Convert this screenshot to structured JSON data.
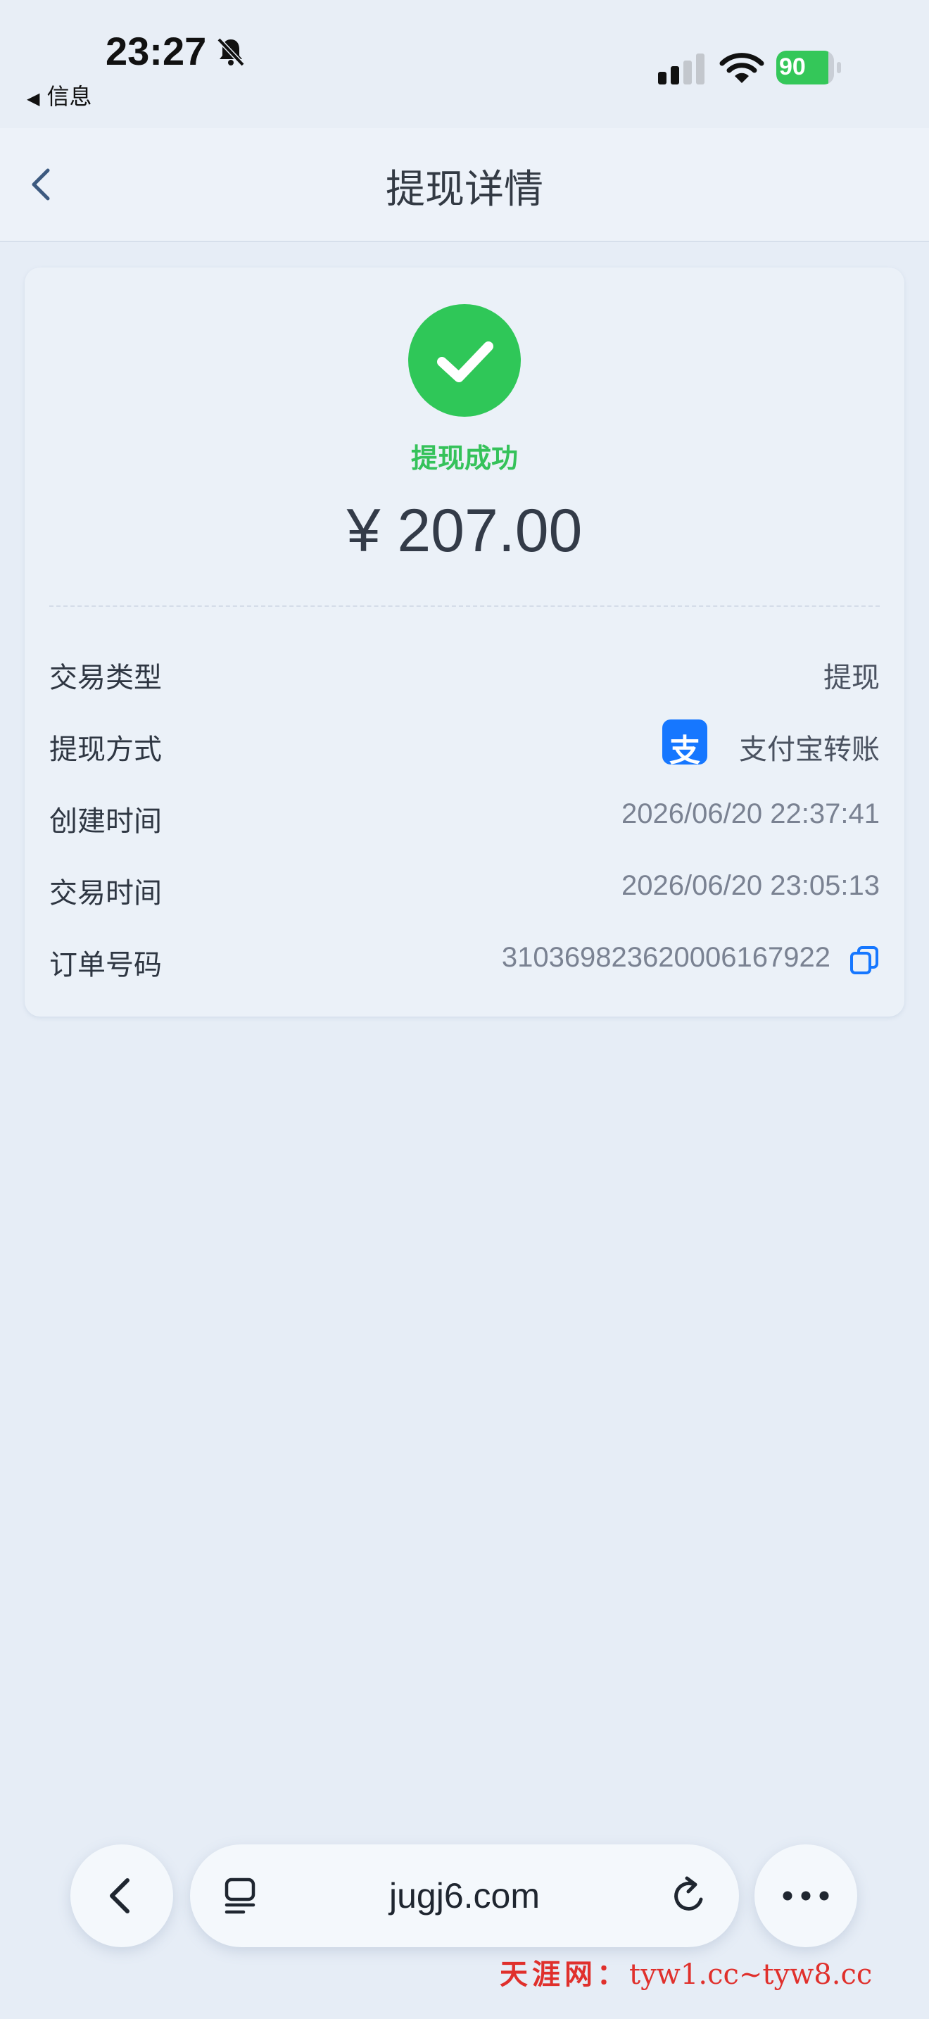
{
  "status_bar": {
    "time": "23:27",
    "back_app": "信息",
    "battery_level": "90",
    "battery_fraction": 0.9,
    "icons": [
      "bell-slash-icon",
      "signal-icon",
      "wifi-icon",
      "battery-charging-icon"
    ]
  },
  "navbar": {
    "title": "提现详情",
    "back_icon": "chevron-left-icon"
  },
  "result": {
    "status_text": "提现成功",
    "amount": "¥ 207.00",
    "status_color": "#2fc758"
  },
  "details": {
    "rows": [
      {
        "label": "交易类型",
        "value": "提现"
      },
      {
        "label": "提现方式",
        "value": "支付宝转账"
      },
      {
        "label": "创建时间",
        "value": "2026/06/20 22:37:41"
      },
      {
        "label": "交易时间",
        "value": "2026/06/20 23:05:13"
      },
      {
        "label": "订单号码",
        "value": "310369823620006167922"
      }
    ],
    "alipay_logo_char": "支",
    "copy_icon": "copy-icon"
  },
  "browser_bar": {
    "url": "jugj6.com",
    "icons": [
      "back-arrow-icon",
      "reader-icon",
      "reload-icon",
      "more-dots-icon"
    ]
  },
  "watermark": {
    "brand": "天涯网：",
    "domains": "tyw1.cc~tyw8.cc"
  },
  "colors": {
    "background": "#e6edf6",
    "success_green": "#2fc758",
    "alipay_blue": "#1677ff",
    "watermark_red": "#e0302c"
  }
}
